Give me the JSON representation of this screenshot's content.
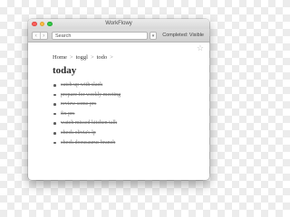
{
  "window": {
    "title": "WorkFlowy"
  },
  "toolbar": {
    "back_glyph": "‹",
    "forward_glyph": "›",
    "search_value": "Search",
    "filter_glyph": "▾",
    "completed_label": "Completed: Visible"
  },
  "icons": {
    "star": "star-icon"
  },
  "breadcrumb": {
    "items": [
      "Home",
      "toggl",
      "todo"
    ],
    "separator": ">"
  },
  "page": {
    "title": "today"
  },
  "items": [
    {
      "text": "catch up with slack",
      "completed": true
    },
    {
      "text": "prepare for weekly meeting",
      "completed": true
    },
    {
      "text": "review some prs",
      "completed": true
    },
    {
      "text": "fix prs",
      "completed": true
    },
    {
      "text": "watch missed kitchen talk",
      "completed": true
    },
    {
      "text": "check olivia's lp",
      "completed": true
    },
    {
      "text": "check docusaurus branch",
      "completed": true
    }
  ],
  "colors": {
    "close": "#fc605c",
    "minimize": "#fdbc40",
    "maximize": "#34c84a"
  }
}
